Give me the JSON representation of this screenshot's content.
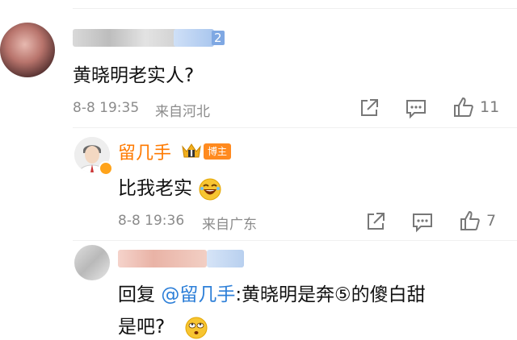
{
  "comment1": {
    "user_badge": "2",
    "text": "黄晓明老实人?",
    "date": "8-8 19:35",
    "location": "来自河北",
    "likes": "11"
  },
  "reply1": {
    "author": "留几手",
    "badge": "博主",
    "crown_level": "I",
    "text": "比我老实",
    "date": "8-8 19:36",
    "location": "来自广东",
    "likes": "7"
  },
  "reply2": {
    "prefix": "回复",
    "mention": "@留几手",
    "text_line1": ":黄晓明是奔⑤的傻白甜",
    "text_line2": "是吧?"
  },
  "icons": [
    "share-icon",
    "comment-icon",
    "like-icon",
    "laugh-emoji",
    "rolleyes-emoji",
    "verified-icon",
    "crown-icon"
  ],
  "colors": {
    "accent_orange": "#ff7a00",
    "mention_blue": "#2d7fd8",
    "meta_gray": "#8b8b8b"
  }
}
